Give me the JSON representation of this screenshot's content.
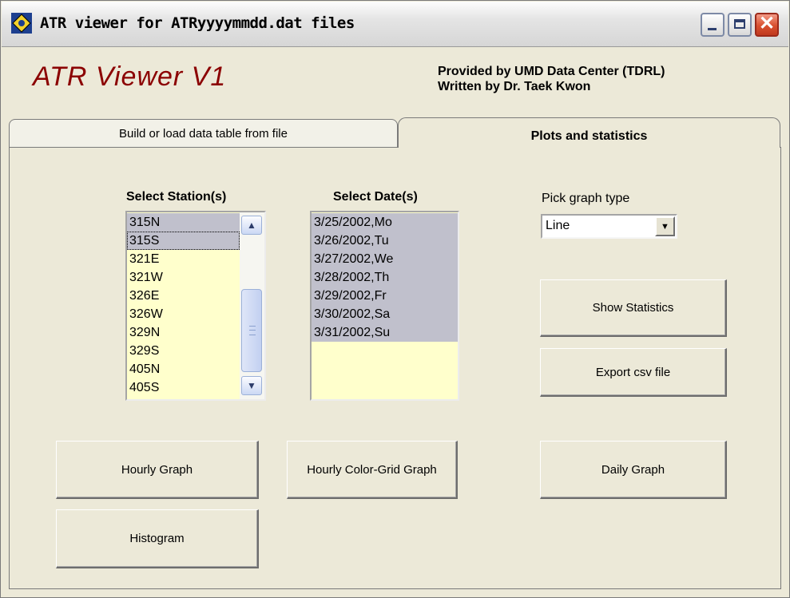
{
  "window": {
    "title": "ATR viewer for ATRyyyymmdd.dat files"
  },
  "header": {
    "app_title": "ATR Viewer V1",
    "credit_line1": "Provided by UMD Data Center (TDRL)",
    "credit_line2": "Written by Dr. Taek Kwon"
  },
  "tabs": [
    {
      "label": "Build or load data table from file",
      "active": false
    },
    {
      "label": "Plots and statistics",
      "active": true
    }
  ],
  "stations": {
    "label": "Select Station(s)",
    "items": [
      "315N",
      "315S",
      "321E",
      "321W",
      "326E",
      "326W",
      "329N",
      "329S",
      "405N",
      "405S"
    ],
    "selected": [
      "315N",
      "315S"
    ],
    "focused": "315S"
  },
  "dates": {
    "label": "Select Date(s)",
    "items": [
      "3/25/2002,Mo",
      "3/26/2002,Tu",
      "3/27/2002,We",
      "3/28/2002,Th",
      "3/29/2002,Fr",
      "3/30/2002,Sa",
      "3/31/2002,Su"
    ],
    "selected": [
      "3/25/2002,Mo",
      "3/26/2002,Tu",
      "3/27/2002,We",
      "3/28/2002,Th",
      "3/29/2002,Fr",
      "3/30/2002,Sa",
      "3/31/2002,Su"
    ]
  },
  "graph_type": {
    "label": "Pick graph type",
    "value": "Line"
  },
  "buttons": {
    "show_statistics": "Show Statistics",
    "export_csv": "Export csv file",
    "hourly_graph": "Hourly Graph",
    "hourly_color_grid": "Hourly Color-Grid Graph",
    "daily_graph": "Daily Graph",
    "histogram": "Histogram"
  },
  "colors": {
    "app_title": "#8b0000",
    "listbox_bg": "#ffffcc",
    "selection_bg": "#c0c0cc",
    "window_bg": "#ece9d8"
  }
}
